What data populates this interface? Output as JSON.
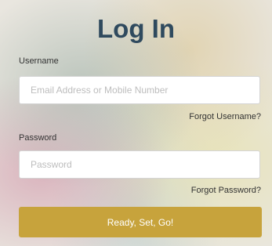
{
  "login": {
    "title": "Log In",
    "username_label": "Username",
    "username_placeholder": "Email Address or Mobile Number",
    "forgot_username": "Forgot Username?",
    "password_label": "Password",
    "password_placeholder": "Password",
    "forgot_password": "Forgot Password?",
    "submit_label": "Ready, Set, Go!"
  },
  "colors": {
    "title": "#2f4a5e",
    "button": "#c7a33c",
    "button_text": "#ffffff"
  }
}
